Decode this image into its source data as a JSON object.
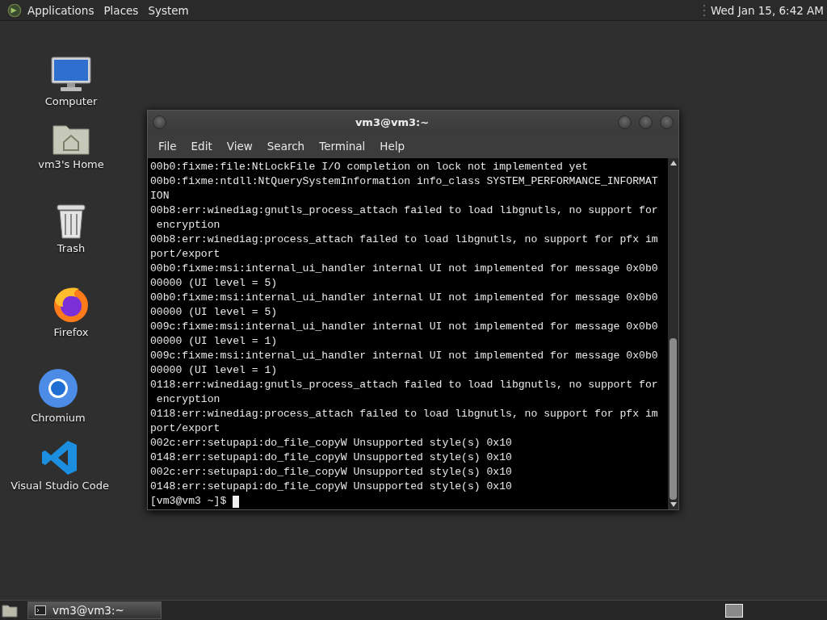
{
  "top_panel": {
    "menus": [
      "Applications",
      "Places",
      "System"
    ],
    "clock": "Wed Jan 15,  6:42 AM"
  },
  "desktop_icons": [
    {
      "label": "Computer",
      "kind": "computer"
    },
    {
      "label": "vm3's Home",
      "kind": "home"
    },
    {
      "label": "Trash",
      "kind": "trash"
    },
    {
      "label": "Firefox",
      "kind": "firefox"
    },
    {
      "label": "Chromium",
      "kind": "chromium"
    },
    {
      "label": "Visual Studio Code",
      "kind": "vscode"
    }
  ],
  "terminal": {
    "title": "vm3@vm3:~",
    "menu": [
      "File",
      "Edit",
      "View",
      "Search",
      "Terminal",
      "Help"
    ],
    "lines": [
      "00b0:fixme:file:NtLockFile I/O completion on lock not implemented yet",
      "00b0:fixme:ntdll:NtQuerySystemInformation info_class SYSTEM_PERFORMANCE_INFORMAT",
      "ION",
      "00b8:err:winediag:gnutls_process_attach failed to load libgnutls, no support for",
      " encryption",
      "00b8:err:winediag:process_attach failed to load libgnutls, no support for pfx im",
      "port/export",
      "00b0:fixme:msi:internal_ui_handler internal UI not implemented for message 0x0b0",
      "00000 (UI level = 5)",
      "00b0:fixme:msi:internal_ui_handler internal UI not implemented for message 0x0b0",
      "00000 (UI level = 5)",
      "009c:fixme:msi:internal_ui_handler internal UI not implemented for message 0x0b0",
      "00000 (UI level = 1)",
      "009c:fixme:msi:internal_ui_handler internal UI not implemented for message 0x0b0",
      "00000 (UI level = 1)",
      "0118:err:winediag:gnutls_process_attach failed to load libgnutls, no support for",
      " encryption",
      "0118:err:winediag:process_attach failed to load libgnutls, no support for pfx im",
      "port/export",
      "002c:err:setupapi:do_file_copyW Unsupported style(s) 0x10",
      "0148:err:setupapi:do_file_copyW Unsupported style(s) 0x10",
      "002c:err:setupapi:do_file_copyW Unsupported style(s) 0x10",
      "0148:err:setupapi:do_file_copyW Unsupported style(s) 0x10"
    ],
    "prompt": "[vm3@vm3 ~]$"
  },
  "taskbar": {
    "tasks": [
      {
        "label": "vm3@vm3:~",
        "selected": true
      }
    ]
  }
}
